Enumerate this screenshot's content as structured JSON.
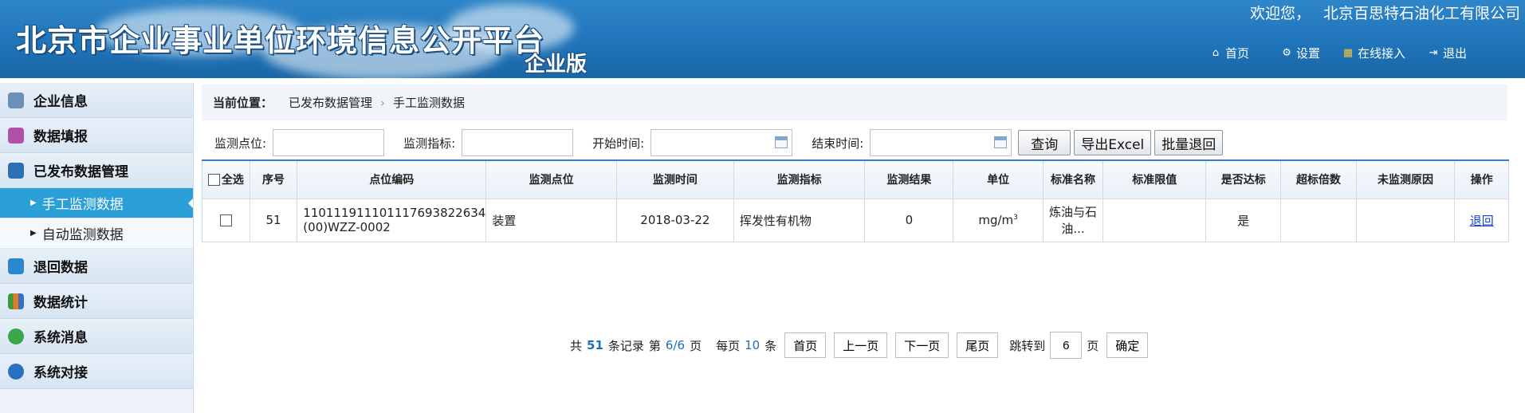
{
  "header": {
    "title": "北京市企业事业单位环境信息公开平台",
    "subtitle": "企业版",
    "welcome": "欢迎您，",
    "company": "北京百思特石油化工有限公司",
    "nav": [
      {
        "label": "首页",
        "icon": "home-icon"
      },
      {
        "label": "设置",
        "icon": "gear-icon"
      },
      {
        "label": "在线接入",
        "icon": "plug-icon"
      },
      {
        "label": "退出",
        "icon": "logout-icon"
      }
    ]
  },
  "sidebar": {
    "items": [
      {
        "label": "企业信息",
        "icon": "building-icon",
        "color": "#6a8fb8"
      },
      {
        "label": "数据填报",
        "icon": "data-entry-icon",
        "color": "#b24fa7"
      },
      {
        "label": "已发布数据管理",
        "icon": "published-data-icon",
        "color": "#2c6fb3"
      },
      {
        "label": "退回数据",
        "icon": "return-icon",
        "color": "#2a88cf"
      },
      {
        "label": "数据统计",
        "icon": "chart-icon",
        "color": "#e07a2a"
      },
      {
        "label": "系统消息",
        "icon": "message-icon",
        "color": "#3aa84a"
      },
      {
        "label": "系统对接",
        "icon": "connect-icon",
        "color": "#2a6fc0"
      }
    ],
    "subitems": [
      {
        "label": "手工监测数据",
        "active": true
      },
      {
        "label": "自动监测数据",
        "active": false
      }
    ]
  },
  "breadcrumb": {
    "label": "当前位置：",
    "path": [
      "已发布数据管理",
      "手工监测数据"
    ]
  },
  "filter": {
    "point_label": "监测点位:",
    "index_label": "监测指标:",
    "start_label": "开始时间:",
    "end_label": "结束时间:",
    "query_btn": "查询",
    "export_btn": "导出Excel",
    "batch_return_btn": "批量退回"
  },
  "table": {
    "select_all": "全选",
    "columns": [
      "序号",
      "点位编码",
      "监测点位",
      "监测时间",
      "监测指标",
      "监测结果",
      "单位",
      "标准名称",
      "标准限值",
      "是否达标",
      "超标倍数",
      "未监测原因",
      "操作"
    ],
    "rows": [
      {
        "seq": "51",
        "code_line1": "11011191110111769382263 4",
        "code": "110111911101117693822634",
        "code_line2": "(00)WZZ-0002",
        "point": "装置",
        "time": "2018-03-22",
        "index": "挥发性有机物",
        "result": "0",
        "unit": "mg/m",
        "unit_sup": "3",
        "standard_line1": "炼油与石",
        "standard_line2": "油...",
        "limit": "",
        "pass": "是",
        "exceed": "",
        "reason": "",
        "action": "退回"
      }
    ]
  },
  "pager": {
    "total_prefix": "共",
    "total": "51",
    "total_suffix": "条记录",
    "page_prefix": "第",
    "page": "6/6",
    "page_suffix": "页",
    "per_page_prefix": "每页",
    "per_page": "10",
    "per_page_suffix": "条",
    "first": "首页",
    "prev": "上一页",
    "next": "下一页",
    "last": "尾页",
    "jump_prefix": "跳转到",
    "jump_value": "6",
    "jump_suffix": "页",
    "confirm": "确定"
  }
}
